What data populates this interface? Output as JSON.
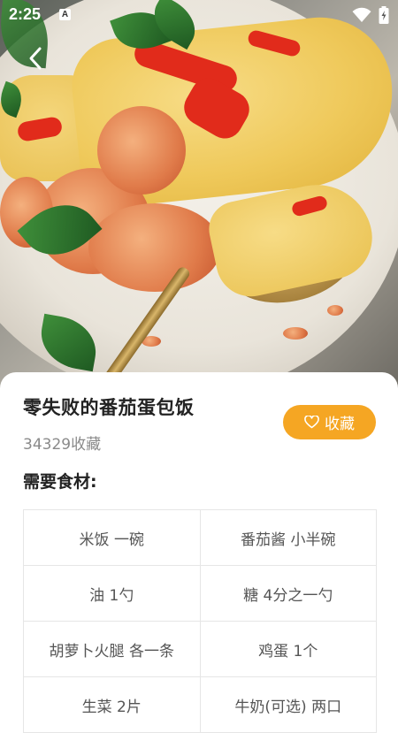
{
  "status_bar": {
    "time": "2:25",
    "indicator": "A"
  },
  "hero": {
    "icon": "back-arrow-icon"
  },
  "recipe": {
    "title": "零失败的番茄蛋包饭",
    "favorite_count": "34329收藏",
    "favorite_button_label": "收藏",
    "ingredients_heading": "需要食材:",
    "ingredients": [
      [
        "米饭 一碗",
        "番茄酱 小半碗"
      ],
      [
        "油 1勺",
        "糖 4分之一勺"
      ],
      [
        "胡萝卜火腿 各一条",
        "鸡蛋 1个"
      ],
      [
        "生菜 2片",
        "牛奶(可选) 两口"
      ]
    ]
  },
  "colors": {
    "accent": "#f5a623",
    "title": "#222222",
    "muted": "#8a8a8a"
  }
}
